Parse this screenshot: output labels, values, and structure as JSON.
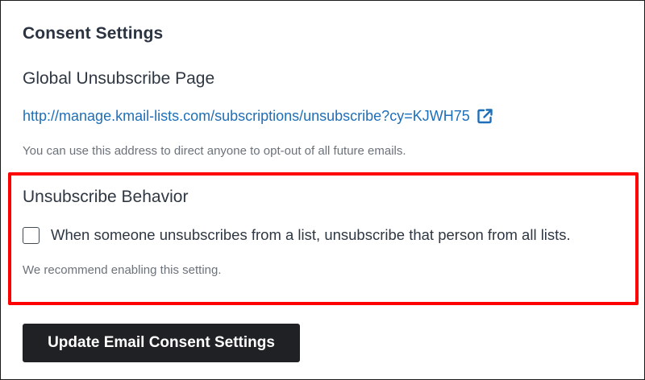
{
  "consent_settings": {
    "title": "Consent Settings"
  },
  "global_unsubscribe": {
    "heading": "Global Unsubscribe Page",
    "url": "http://manage.kmail-lists.com/subscriptions/unsubscribe?cy=KJWH75",
    "link_icon": "external-link-icon",
    "help_text": "You can use this address to direct anyone to opt-out of all future emails."
  },
  "unsubscribe_behavior": {
    "heading": "Unsubscribe Behavior",
    "checkbox_label": "When someone unsubscribes from a list, unsubscribe that person from all lists.",
    "checkbox_checked": false,
    "help_text": "We recommend enabling this setting.",
    "highlight_color": "#ff0000"
  },
  "actions": {
    "update_label": "Update Email Consent Settings"
  },
  "colors": {
    "link": "#1e6fb8",
    "button_bg": "#1f2124",
    "button_text": "#ffffff",
    "muted_text": "#6c727a"
  }
}
